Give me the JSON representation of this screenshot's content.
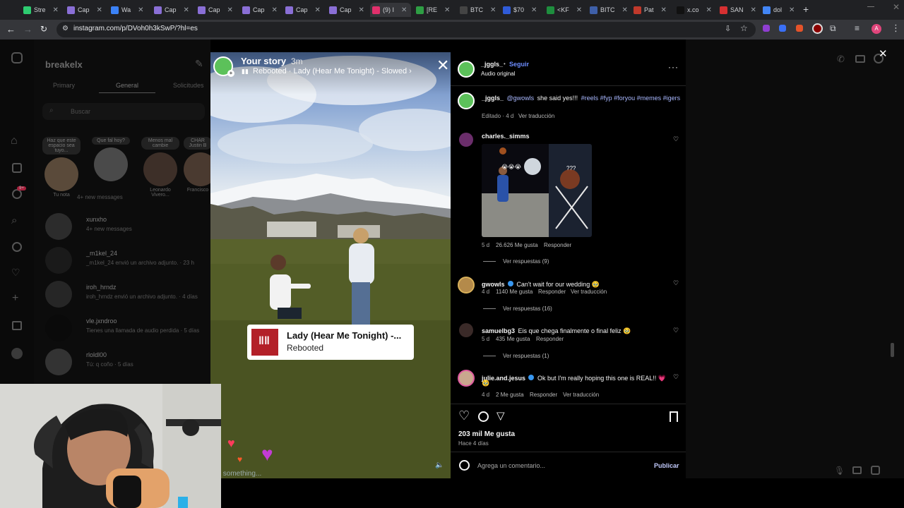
{
  "browser": {
    "tabs": [
      {
        "label": "Stre",
        "color": "#2ecc71"
      },
      {
        "label": "Cap",
        "color": "#8a6fd6"
      },
      {
        "label": "Wa",
        "color": "#3b82f6"
      },
      {
        "label": "Cap",
        "color": "#8a6fd6"
      },
      {
        "label": "Cap",
        "color": "#8a6fd6"
      },
      {
        "label": "Cap",
        "color": "#8a6fd6"
      },
      {
        "label": "Cap",
        "color": "#8a6fd6"
      },
      {
        "label": "Cap",
        "color": "#8a6fd6"
      },
      {
        "label": "(9) I",
        "color": "#e1306c"
      },
      {
        "label": "[RE",
        "color": "#2e9e44"
      },
      {
        "label": "BTC",
        "color": "#444444"
      },
      {
        "label": "$70",
        "color": "#2f5bd8"
      },
      {
        "label": "<KF",
        "color": "#1e8e3e"
      },
      {
        "label": "BITC",
        "color": "#3e5fa8"
      },
      {
        "label": "Pat",
        "color": "#c0392b"
      },
      {
        "label": "x.co",
        "color": "#111111"
      },
      {
        "label": "SAN",
        "color": "#d63031"
      },
      {
        "label": "dol",
        "color": "#4285f4"
      }
    ],
    "new_tab": "+",
    "url": "instagram.com/p/DVoh0h3kSwP/?hl=es",
    "profile_initial": "A"
  },
  "dm": {
    "account": "breakelx",
    "tabs": [
      "Primary",
      "General",
      "Solicitudes"
    ],
    "search_placeholder": "Buscar",
    "notes": [
      {
        "bubble": "Haz que este espacio sea tuyo...",
        "label": "Tu nota"
      },
      {
        "bubble": "Que fal hoy?",
        "label": ""
      },
      {
        "bubble": "Menos mal cambie",
        "label": "Leonardo Vivero..."
      },
      {
        "bubble": "CHAR Justin B",
        "label": "Francisco"
      }
    ],
    "first_meta": "4+ new messages",
    "conversations": [
      {
        "name": "xunxho",
        "sub": "4+ new messages"
      },
      {
        "name": "_m1kel_24",
        "sub": "_m1kel_24 envió un archivo adjunto. · 23 h"
      },
      {
        "name": "iroh_hrndz",
        "sub": "iroh_hrndz envió un archivo adjunto. · 4 días"
      },
      {
        "name": "vle.jxndroo",
        "sub": "Tienes una llamada de audio perdida · 5 días"
      },
      {
        "name": "rloldl00",
        "sub": "Tú: q coño · 5 días"
      }
    ],
    "badge": "9+"
  },
  "story": {
    "title": "Your story",
    "time": "3m",
    "music": "Rebooted · Lady (Hear Me Tonight) - Slowed ›",
    "song_title": "Lady (Hear Me Tonight) -...",
    "song_artist": "Rebooted",
    "footer_text": "y something..."
  },
  "post": {
    "author": "_jggls_",
    "follow": "Seguir",
    "audio": "Audio original",
    "caption_user": "_jggls_",
    "caption_mention": "@gwowls",
    "caption_text": "she said yes!!!",
    "caption_tags": "#reels #fyp #foryou #memes #igers",
    "caption_meta": "Editado · 4 d",
    "translate": "Ver traducción",
    "likes": "203 mil Me gusta",
    "date": "Hace 4 días",
    "comment_placeholder": "Agrega un comentario...",
    "publish": "Publicar"
  },
  "comments": [
    {
      "user": "charles._simms",
      "text": "",
      "time": "5 d",
      "likes": "26.626 Me gusta",
      "reply": "Responder",
      "translate": "",
      "replies": "Ver respuestas (9)",
      "image_label": "???"
    },
    {
      "user": "gwowls",
      "text": "Can't wait for our wedding 🥹",
      "time": "4 d",
      "likes": "1140 Me gusta",
      "reply": "Responder",
      "translate": "Ver traducción",
      "replies": "Ver respuestas (16)"
    },
    {
      "user": "samuelbg3",
      "text": "Eis que chega finalmente o final feliz 🥹",
      "time": "5 d",
      "likes": "435 Me gusta",
      "reply": "Responder",
      "translate": "",
      "replies": "Ver respuestas (1)"
    },
    {
      "user": "julie.and.jesus",
      "text": "Ok but I'm really hoping this one is REAL!! 💗",
      "text2": "🥹",
      "time": "4 d",
      "likes": "2 Me gusta",
      "reply": "Responder",
      "translate": "Ver traducción",
      "replies": ""
    }
  ],
  "colors": {
    "accent_link": "#a9b8ff",
    "follow_blue": "#6d8dff",
    "instagram_pink": "#e1306c"
  }
}
